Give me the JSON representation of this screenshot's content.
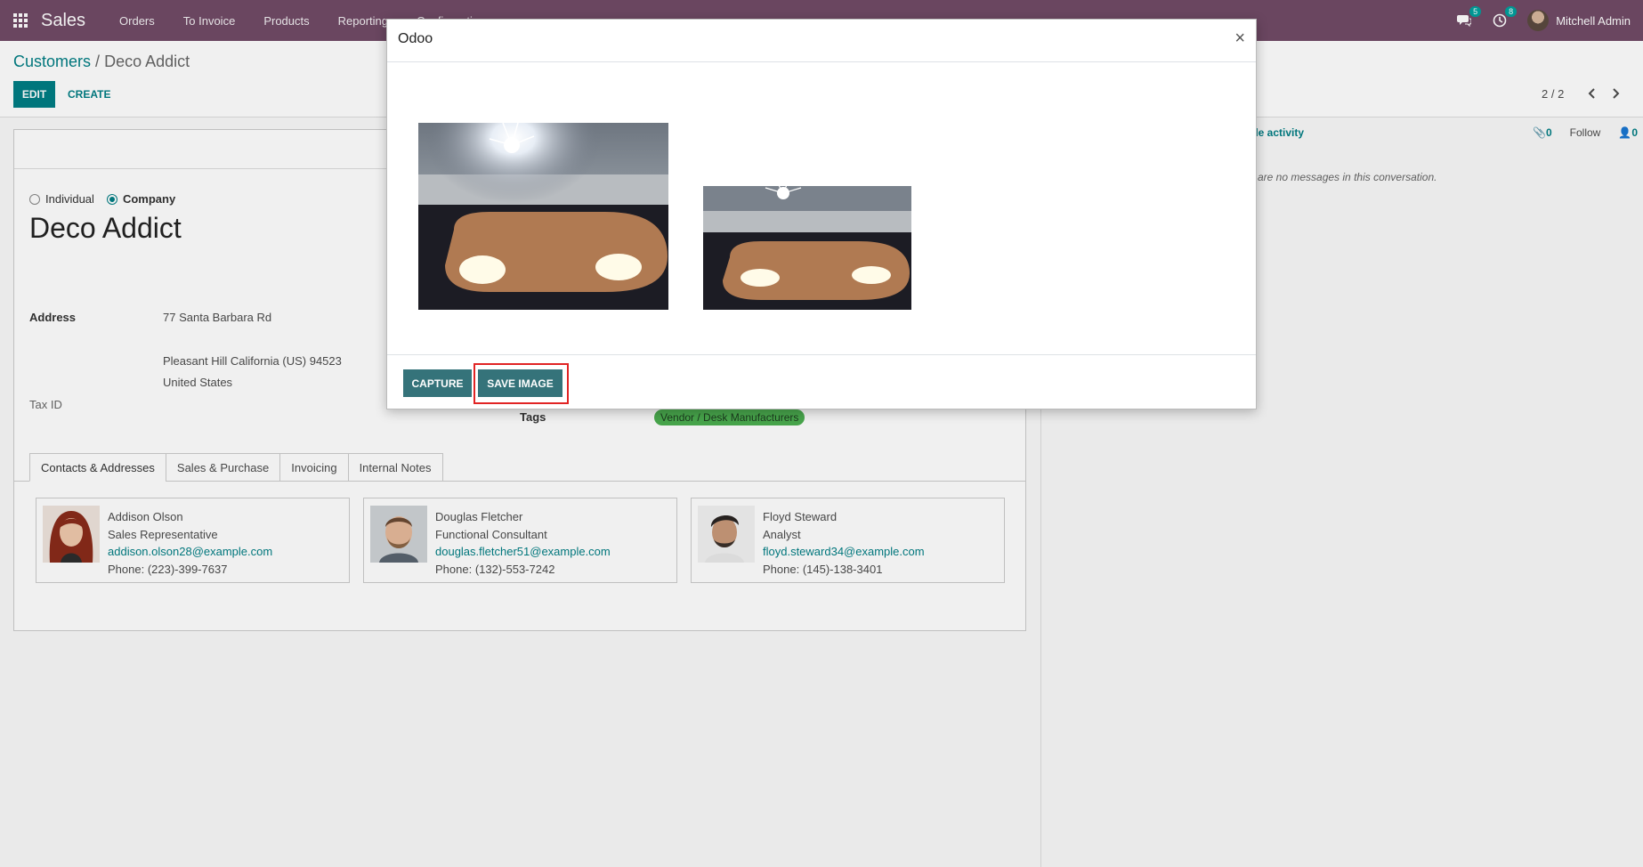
{
  "navbar": {
    "brand": "Sales",
    "menu": [
      "Orders",
      "To Invoice",
      "Products",
      "Reporting",
      "Configuration"
    ],
    "messages_badge": "5",
    "activities_badge": "8",
    "user_name": "Mitchell Admin"
  },
  "control_panel": {
    "breadcrumb_parent": "Customers",
    "breadcrumb_sep": "/",
    "breadcrumb_current": "Deco Addict",
    "edit_label": "EDIT",
    "create_label": "CREATE",
    "pager": "2 / 2"
  },
  "form": {
    "radio_individual": "Individual",
    "radio_company": "Company",
    "selected": "Company",
    "name": "Deco Addict",
    "address_label": "Address",
    "street": "77 Santa Barbara Rd",
    "city_line": "Pleasant Hill  California (US)  94523",
    "country": "United States",
    "tax_id_label": "Tax ID",
    "tags_label": "Tags",
    "tag": "Vendor / Desk Manufacturers"
  },
  "tabs": [
    "Contacts & Addresses",
    "Sales & Purchase",
    "Invoicing",
    "Internal Notes"
  ],
  "contacts": [
    {
      "name": "Addison Olson",
      "title": "Sales Representative",
      "email": "addison.olson28@example.com",
      "phone": "Phone: (223)-399-7637"
    },
    {
      "name": "Douglas Fletcher",
      "title": "Functional Consultant",
      "email": "douglas.fletcher51@example.com",
      "phone": "Phone: (132)-553-7242"
    },
    {
      "name": "Floyd Steward",
      "title": "Analyst",
      "email": "floyd.steward34@example.com",
      "phone": "Phone: (145)-138-3401"
    }
  ],
  "chatter": {
    "activity_label": "ule activity",
    "attachments": "0",
    "follow": "Follow",
    "followers": "0",
    "empty": "e are no messages in this conversation."
  },
  "modal": {
    "title": "Odoo",
    "close": "×",
    "capture_label": "CAPTURE",
    "save_label": "SAVE IMAGE"
  }
}
